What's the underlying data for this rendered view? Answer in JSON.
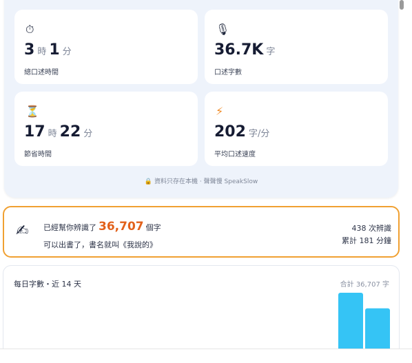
{
  "stats": {
    "speak_time": {
      "icon": "stopwatch-icon",
      "glyph": "⏱",
      "hours": "3",
      "hours_unit": "時",
      "minutes": "1",
      "minutes_unit": "分",
      "label": "總口述時間"
    },
    "char_count": {
      "icon": "microphone-icon",
      "glyph": "🎙",
      "value": "36.7K",
      "unit": "字",
      "label": "口述字數"
    },
    "saved_time": {
      "icon": "hourglass-icon",
      "glyph": "⏳",
      "hours": "17",
      "hours_unit": "時",
      "minutes": "22",
      "minutes_unit": "分",
      "label": "節省時間"
    },
    "speed": {
      "icon": "lightning-icon",
      "glyph": "⚡",
      "value": "202",
      "unit": "字/分",
      "label": "平均口述速度"
    },
    "footer_glyph": "🔒",
    "footer_note": "資料只存在本機 · 聲聲慢 SpeakSlow"
  },
  "milestone": {
    "icon_glyph": "✍",
    "prefix": "已經幫你辨識了",
    "count": "36,707",
    "suffix": "個字",
    "subtitle": "可以出書了，書名就叫《我說的》",
    "recognitions": "438 次辨識",
    "total_minutes": "累計 181 分鐘"
  },
  "daily": {
    "title": "每日字數・近 14 天",
    "total": "合計 36,707 字"
  },
  "chart_data": {
    "type": "bar",
    "title": "每日字數・近 14 天",
    "note": "only the two most recent bars are visible; heights relative, chart cut off at the bottom",
    "values": [
      1.0,
      0.73
    ],
    "color": "#35c4f5"
  }
}
